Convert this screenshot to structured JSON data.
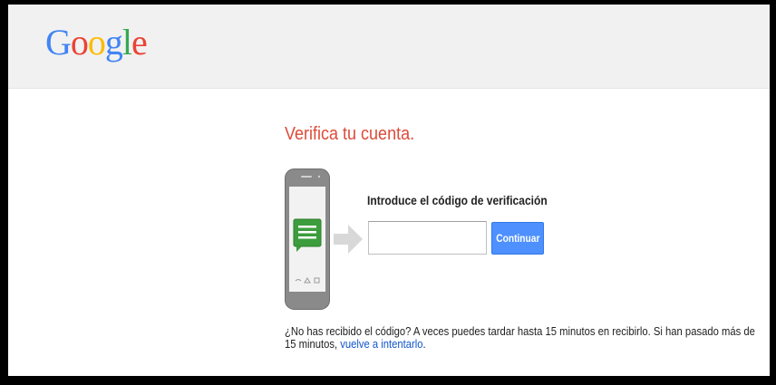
{
  "header": {
    "logo_letters": [
      {
        "char": "G",
        "color": "#4285f4"
      },
      {
        "char": "o",
        "color": "#ea4335"
      },
      {
        "char": "o",
        "color": "#fbbc05"
      },
      {
        "char": "g",
        "color": "#4285f4"
      },
      {
        "char": "l",
        "color": "#34a853"
      },
      {
        "char": "e",
        "color": "#ea4335"
      }
    ]
  },
  "main": {
    "title": "Verifica tu cuenta.",
    "code_label": "Introduce el código de verificación",
    "code_value": "",
    "continue_label": "Continuar",
    "help_text_1": "¿No has recibido el código? A veces puedes tardar hasta 15 minutos en recibirlo. Si han pasado más de 15 minutos, ",
    "retry_link": "vuelve a intentarlo",
    "help_text_2": "."
  },
  "icons": {
    "phone": "smartphone-with-message-icon",
    "arrow": "arrow-right-icon"
  },
  "colors": {
    "title": "#dd4b39",
    "button": "#4d90fe",
    "link": "#1155cc",
    "header_bg": "#f1f1f1",
    "message_bubble": "#3c9d3c"
  }
}
